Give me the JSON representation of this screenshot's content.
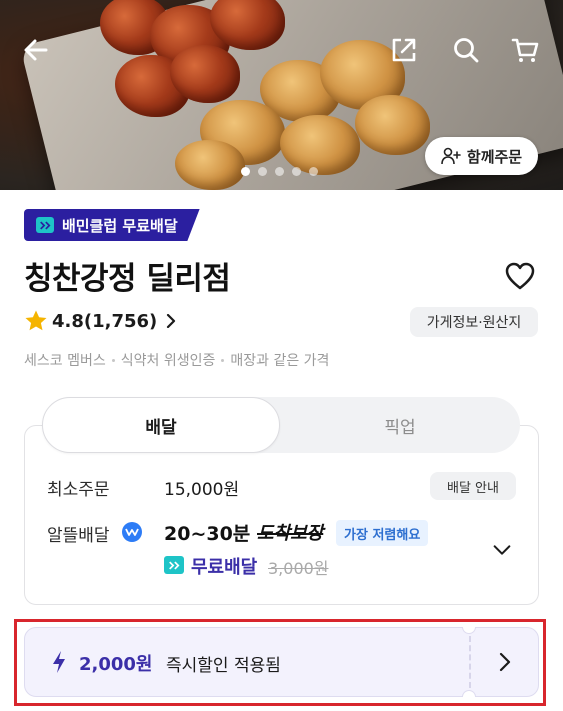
{
  "header": {
    "together_order_label": "함께주문",
    "image_dots": 5,
    "active_dot": 1
  },
  "store": {
    "club_badge": "배민클럽 무료배달",
    "name": "칭찬강정 딜리점",
    "rating": "4.8(1,756)",
    "info_button": "가게정보·원산지",
    "certifications": [
      "세스코 멤버스",
      "식약처 위생인증",
      "매장과 같은 가격"
    ]
  },
  "delivery": {
    "tabs": [
      "배달",
      "픽업"
    ],
    "active_tab": "배달",
    "min_order_label": "최소주문",
    "min_order_value": "15,000원",
    "guide_button": "배달 안내",
    "type_label": "알뜰배달",
    "time": "20~30분",
    "guarantee": "도착보장",
    "cheapest_tag": "가장 저렴해요",
    "free_delivery": "무료배달",
    "original_fee": "3,000원"
  },
  "discount": {
    "amount": "2,000원",
    "text": "즉시할인 적용됨"
  },
  "colors": {
    "brand_purple": "#3b2fa8",
    "club_navy": "#2b1fa0",
    "mint": "#1ec4c7",
    "highlight_red": "#d8262d",
    "star": "#f5b400"
  }
}
